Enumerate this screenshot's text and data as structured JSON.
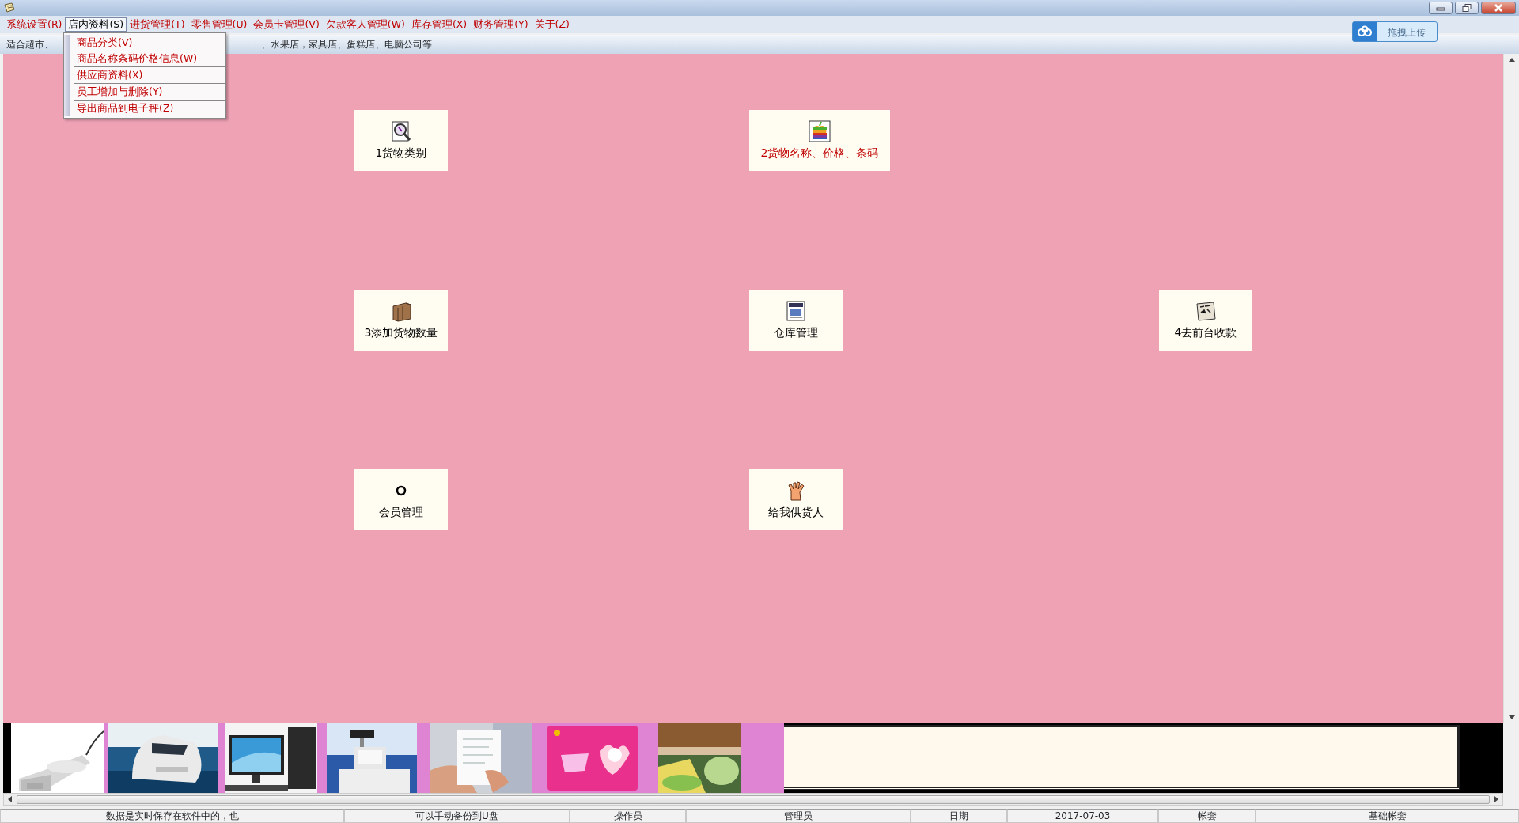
{
  "menu": [
    {
      "label": "系统设置(R)",
      "selected": false
    },
    {
      "label": "店内资料(S)",
      "selected": true
    },
    {
      "label": "进货管理(T)",
      "selected": false
    },
    {
      "label": "零售管理(U)",
      "selected": false
    },
    {
      "label": "会员卡管理(V)",
      "selected": false
    },
    {
      "label": "欠款客人管理(W)",
      "selected": false
    },
    {
      "label": "库存管理(X)",
      "selected": false
    },
    {
      "label": "财务管理(Y)",
      "selected": false
    },
    {
      "label": "关于(Z)",
      "selected": false
    }
  ],
  "dropdown": [
    "商品分类(V)",
    "商品名称条码价格信息(W)",
    "供应商资料(X)",
    "员工增加与删除(Y)",
    "导出商品到电子秤(Z)"
  ],
  "info_line": [
    "适合超市、",
    "、水果店，家具店、蛋糕店、电脑公司等"
  ],
  "upload_button": "拖拽上传",
  "tiles": [
    {
      "label": "1货物类别",
      "highlighted": false
    },
    {
      "label": "2货物名称、价格、条码",
      "highlighted": true
    },
    {
      "label": "3添加货物数量",
      "highlighted": false
    },
    {
      "label": "仓库管理",
      "highlighted": false
    },
    {
      "label": "4去前台收款",
      "highlighted": false
    },
    {
      "label": "会员管理",
      "highlighted": false
    },
    {
      "label": "给我供货人",
      "highlighted": false
    }
  ],
  "status_bar": [
    "数据是实时保存在软件中的，也",
    "可以手动备份到U盘",
    "操作员",
    "管理员",
    "日期",
    "2017-07-03",
    "帐套",
    "基础帐套"
  ]
}
